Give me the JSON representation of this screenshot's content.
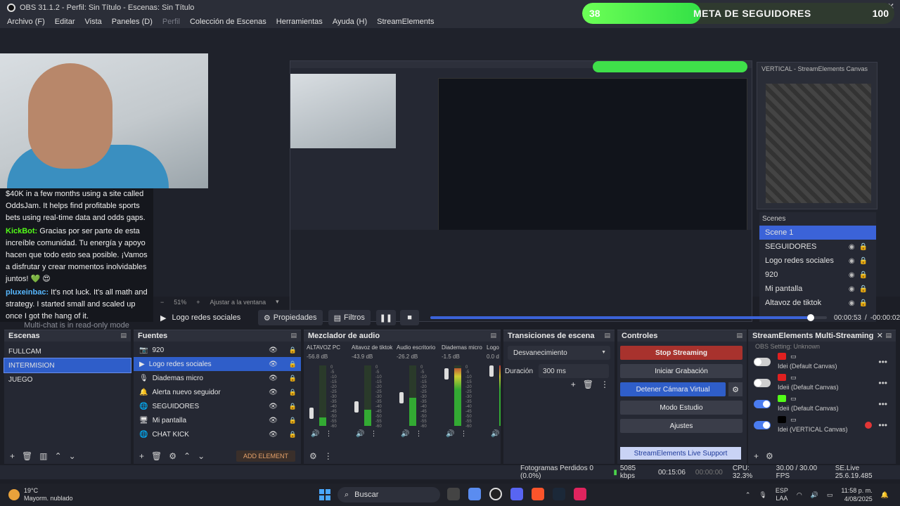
{
  "window": {
    "title": "OBS 31.1.2 - Perfil: Sin Título - Escenas: Sin Título",
    "controls": [
      "—",
      "☐",
      "✕"
    ]
  },
  "menu": [
    "Archivo (F)",
    "Editar",
    "Vista",
    "Paneles (D)",
    "Perfil",
    "Colección de Escenas",
    "Herramientas",
    "Ayuda (H)",
    "StreamElements"
  ],
  "goal": {
    "current": "38",
    "label": "META DE SEGUIDORES",
    "max": "100",
    "progress_fraction": 0.38,
    "color": "#4cf04a"
  },
  "chat": {
    "first_message": "$40K in a few months using a site called OddsJam. It helps find profitable sports bets using real-time data and odds gaps.",
    "messages": [
      {
        "user": "KickBot:",
        "text": " Gracias por ser parte de esta increíble comunidad. Tu energía y apoyo hacen que todo esto sea posible. ¡Vamos a disfrutar y crear momentos inolvidables juntos! 💚 😍"
      },
      {
        "user": "pluxeinbac:",
        "text": " It's not luck. It's all math and strategy. I started small and scaled up once I got the hang of it."
      }
    ],
    "read_only": "Multi-chat is in read-only mode"
  },
  "vertical_canvas": {
    "title": "VERTICAL - StreamElements Canvas",
    "scenes_title": "Scenes",
    "scenes": [
      "Scene 1"
    ],
    "sources": [
      "SEGUIDORES",
      "Logo redes sociales",
      "920",
      "Mi pantalla",
      "Altavoz de tiktok"
    ]
  },
  "zoom": {
    "level": "51%",
    "fit": "Ajustar a la ventana"
  },
  "transport": {
    "current_source": "Logo redes sociales",
    "properties": "Propiedades",
    "filters": "Filtros",
    "elapsed": "00:00:53",
    "separator": "/",
    "remaining": "-00:00:02",
    "progress_fraction": 0.96
  },
  "scenes_dock": {
    "title": "Escenas",
    "items": [
      "FULLCAM",
      "INTERMISION",
      "JUEGO"
    ],
    "selected": 1
  },
  "sources_dock": {
    "title": "Fuentes",
    "items": [
      {
        "icon": "📷",
        "name": "920"
      },
      {
        "icon": "▶",
        "name": "Logo redes sociales"
      },
      {
        "icon": "🎙",
        "name": "Diademas micro"
      },
      {
        "icon": "🔔",
        "name": "Alerta nuevo seguidor"
      },
      {
        "icon": "🌐",
        "name": "SEGUIDORES"
      },
      {
        "icon": "🖥",
        "name": "Mi pantalla"
      },
      {
        "icon": "🌐",
        "name": "CHAT KICK"
      }
    ],
    "selected": 1,
    "add_element": "ADD ELEMENT"
  },
  "mixer_dock": {
    "title": "Mezclador de audio",
    "channels": [
      {
        "name": "ALTAVOZ PC",
        "db": "-56.8 dB",
        "level": 0.14
      },
      {
        "name": "Altavoz de tiktok",
        "db": "-43.9 dB",
        "level": 0.27
      },
      {
        "name": "Audio escritorio",
        "db": "-26.2 dB",
        "level": 0.46
      },
      {
        "name": "Diademas micro",
        "db": "-1.5 dB",
        "level": 0.95
      },
      {
        "name": "Logo",
        "db": "0.0 d",
        "level": 1.0
      }
    ],
    "scale": [
      "0",
      "-5",
      "-10",
      "-15",
      "-20",
      "-25",
      "-30",
      "-35",
      "-40",
      "-45",
      "-50",
      "-55",
      "-60"
    ]
  },
  "transitions_dock": {
    "title": "Transiciones de escena",
    "selected": "Desvanecimiento",
    "duration_label": "Duración",
    "duration_value": "300 ms"
  },
  "controls_dock": {
    "title": "Controles",
    "stop_streaming": "Stop Streaming",
    "start_recording": "Iniciar Grabación",
    "stop_virtual_cam": "Detener Cámara Virtual",
    "studio_mode": "Modo Estudio",
    "settings": "Ajustes",
    "support": "StreamElements Live Support"
  },
  "se_dock": {
    "title": "StreamElements Multi-Streaming",
    "obs_setting": "OBS Setting: Unknown",
    "outputs": [
      {
        "account": "Idei (Default Canvas)",
        "enabled": false,
        "platform_color": "#e02020",
        "error": false
      },
      {
        "account": "Ideii (Default Canvas)",
        "enabled": false,
        "platform_color": "#e02020",
        "error": false
      },
      {
        "account": "Ideii (Default Canvas)",
        "enabled": true,
        "platform_color": "#53fc18",
        "error": false
      },
      {
        "account": "Idei (VERTICAL Canvas)",
        "enabled": true,
        "platform_color": "#000000",
        "error": true
      }
    ]
  },
  "status": {
    "dropped": "Fotogramas Perdidos 0 (0.0%)",
    "bitrate": "5085 kbps",
    "stream_time": "00:15:06",
    "rec_time": "00:00:00",
    "cpu": "CPU: 32.3%",
    "fps": "30.00 / 30.00 FPS",
    "se_version": "SE.Live 25.6.19.485"
  },
  "taskbar": {
    "temp": "19°C",
    "weather": "Mayorm. nublado",
    "search": "Buscar",
    "lang_top": "ESP",
    "lang_bottom": "LAA",
    "time": "11:58 p. m.",
    "date": "4/08/2025"
  },
  "colors": {
    "accent": "#2f5ec9",
    "stop": "#a8322d",
    "kick": "#53fc18"
  }
}
